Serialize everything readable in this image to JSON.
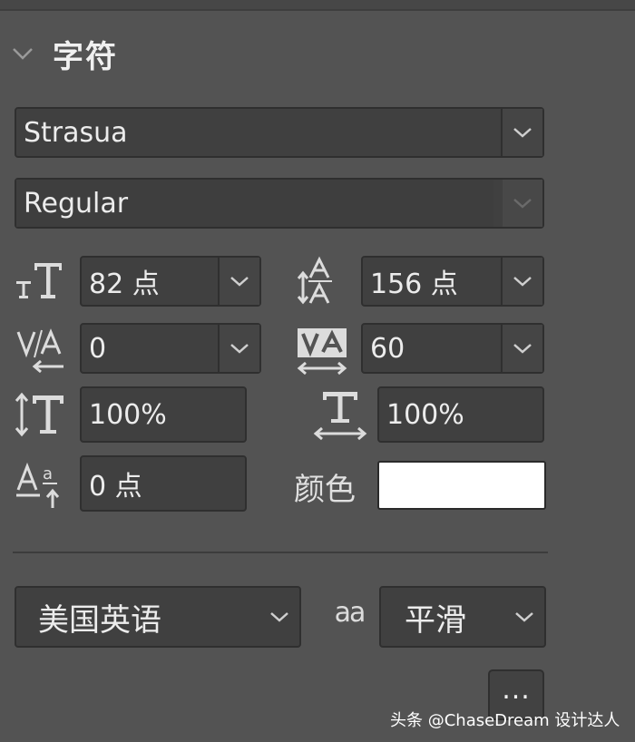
{
  "panel": {
    "section_title": "字符"
  },
  "font": {
    "family": "Strasua",
    "style": "Regular"
  },
  "metrics": {
    "font_size": "82 点",
    "leading": "156 点",
    "kerning": "0",
    "tracking": "60",
    "vertical_scale": "100%",
    "horizontal_scale": "100%",
    "baseline_shift": "0 点"
  },
  "color": {
    "label": "颜色",
    "value": "#ffffff"
  },
  "language": {
    "value": "美国英语"
  },
  "antialias": {
    "icon_text": "aa",
    "value": "平滑"
  },
  "more": {
    "label": "..."
  },
  "watermark": {
    "text": "头条 @ChaseDream 设计达人"
  }
}
